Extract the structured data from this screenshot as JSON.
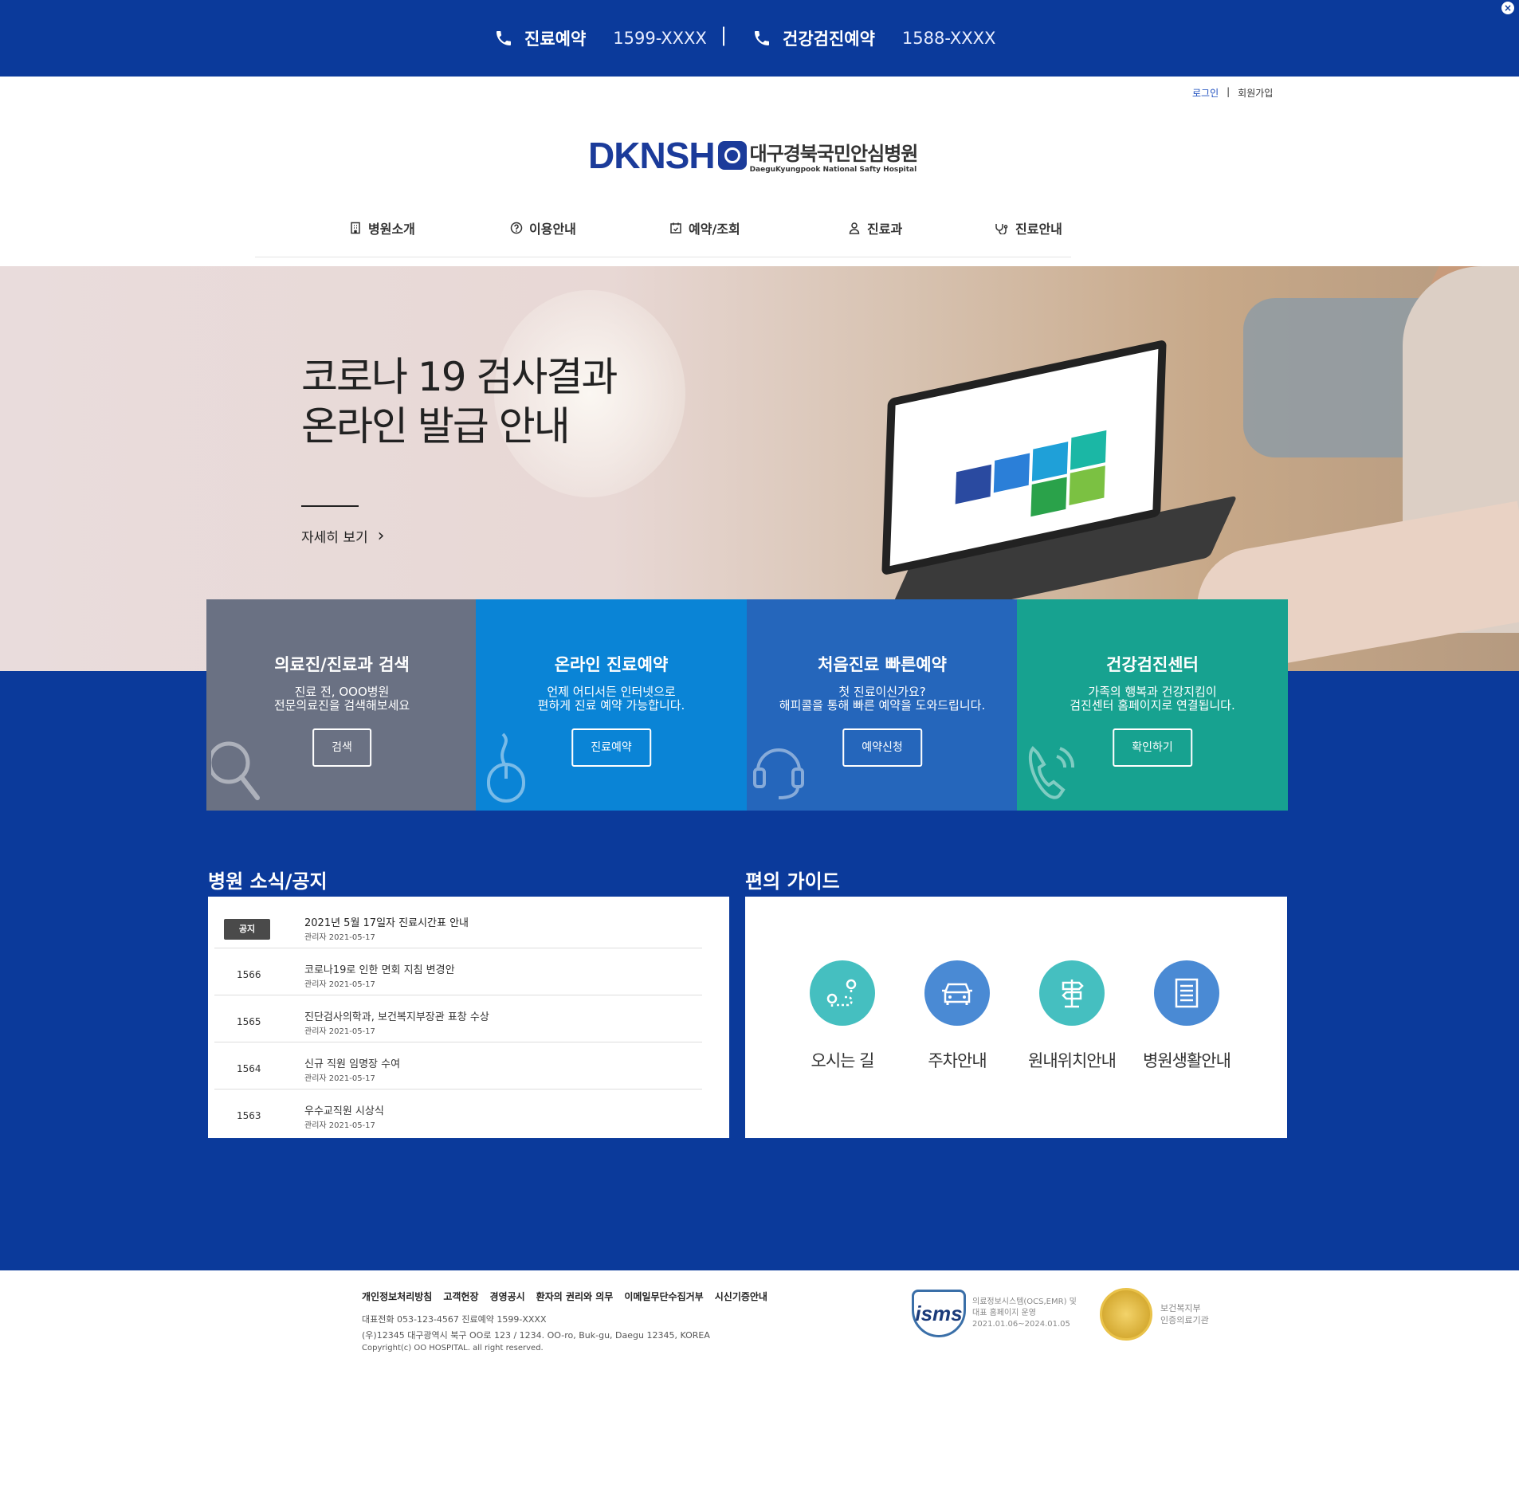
{
  "topbar": {
    "reservation_label": "진료예약",
    "reservation_number": "1599-XXXX",
    "separator": "|",
    "checkup_label": "건강검진예약",
    "checkup_number": "1588-XXXX"
  },
  "util": {
    "login": "로그인",
    "separator": "|",
    "signup": "회원가입"
  },
  "logo": {
    "brand": "DKNSH",
    "name_kr": "대구경북국민안심병원",
    "name_en": "DaeguKyungpook National Safty Hospital"
  },
  "nav": {
    "items": [
      {
        "label": "병원소개",
        "icon": "building-icon"
      },
      {
        "label": "이용안내",
        "icon": "question-icon"
      },
      {
        "label": "예약/조회",
        "icon": "calendar-icon"
      },
      {
        "label": "진료과",
        "icon": "person-icon"
      },
      {
        "label": "진료안내",
        "icon": "stethoscope-icon"
      }
    ],
    "search_placeholder": ""
  },
  "hero": {
    "title_line1": "코로나 19 검사결과",
    "title_line2": "온라인 발급 안내",
    "more_label": "자세히 보기",
    "more_arrow": "›"
  },
  "cards": [
    {
      "title": "의료진/진료과 검색",
      "line1": "진료 전, OOO병원",
      "line2": "전문의료진을 검색해보세요",
      "button": "검색",
      "color": "#6a7183"
    },
    {
      "title": "온라인 진료예약",
      "line1": "언제 어디서든 인터넷으로",
      "line2": "편하게 진료 예약 가능합니다.",
      "button": "진료예약",
      "color": "#0a84d6"
    },
    {
      "title": "처음진료 빠른예약",
      "line1": "첫 진료이신가요?",
      "line2": "해피콜을 통해 빠른 예약을 도와드립니다.",
      "button": "예약신청",
      "color": "#2566bb"
    },
    {
      "title": "건강검진센터",
      "line1": "가족의 행복과 건강지킴이",
      "line2": "검진센터 홈페이지로 연결됩니다.",
      "button": "확인하기",
      "color": "#17a290"
    }
  ],
  "notice": {
    "title": "병원 소식/공지",
    "rows": [
      {
        "num": "공지",
        "title": "2021년 5월 17일자 진료시간표 안내",
        "meta": "관리자   2021-05-17"
      },
      {
        "num": "1566",
        "title": "코로나19로 인한 면회 지침 변경안",
        "meta": "관리자 2021-05-17"
      },
      {
        "num": "1565",
        "title": "진단검사의학과, 보건복지부장관 표창 수상",
        "meta": "관리자 2021-05-17"
      },
      {
        "num": "1564",
        "title": "신규 직원 임명장 수여",
        "meta": "관리자 2021-05-17"
      },
      {
        "num": "1563",
        "title": "우수교직원 시상식",
        "meta": "관리자 2021-05-17"
      }
    ]
  },
  "guide": {
    "title": "편의 가이드",
    "items": [
      {
        "label": "오시는 길",
        "icon": "map-route-icon",
        "color": "#45bfc0"
      },
      {
        "label": "주차안내",
        "icon": "car-icon",
        "color": "#4a8ad4"
      },
      {
        "label": "원내위치안내",
        "icon": "signpost-icon",
        "color": "#45bfc0"
      },
      {
        "label": "병원생활안내",
        "icon": "document-icon",
        "color": "#4a8ad4"
      }
    ]
  },
  "footer": {
    "links": [
      "개인정보처리방침",
      "고객헌장",
      "경영공시",
      "환자의 권리와 의무",
      "이메일무단수집거부",
      "시신기증안내"
    ],
    "phone": "대표전화 053-123-4567 진료예약 1599-XXXX",
    "address": "(우)12345 대구광역시 북구 OO로 123 / 1234. OO-ro, Buk-gu, Daegu 12345, KOREA",
    "copyright": "Copyright(c) OO HOSPITAL. all right reserved.",
    "isms_logo": "isms",
    "isms_line1": "의료정보시스템(OCS,EMR) 및",
    "isms_line2": "대표 홈페이지 운영",
    "isms_line3": "2021.01.06~2024.01.05",
    "cert_line1": "보건복지부",
    "cert_line2": "인증의료기관"
  }
}
